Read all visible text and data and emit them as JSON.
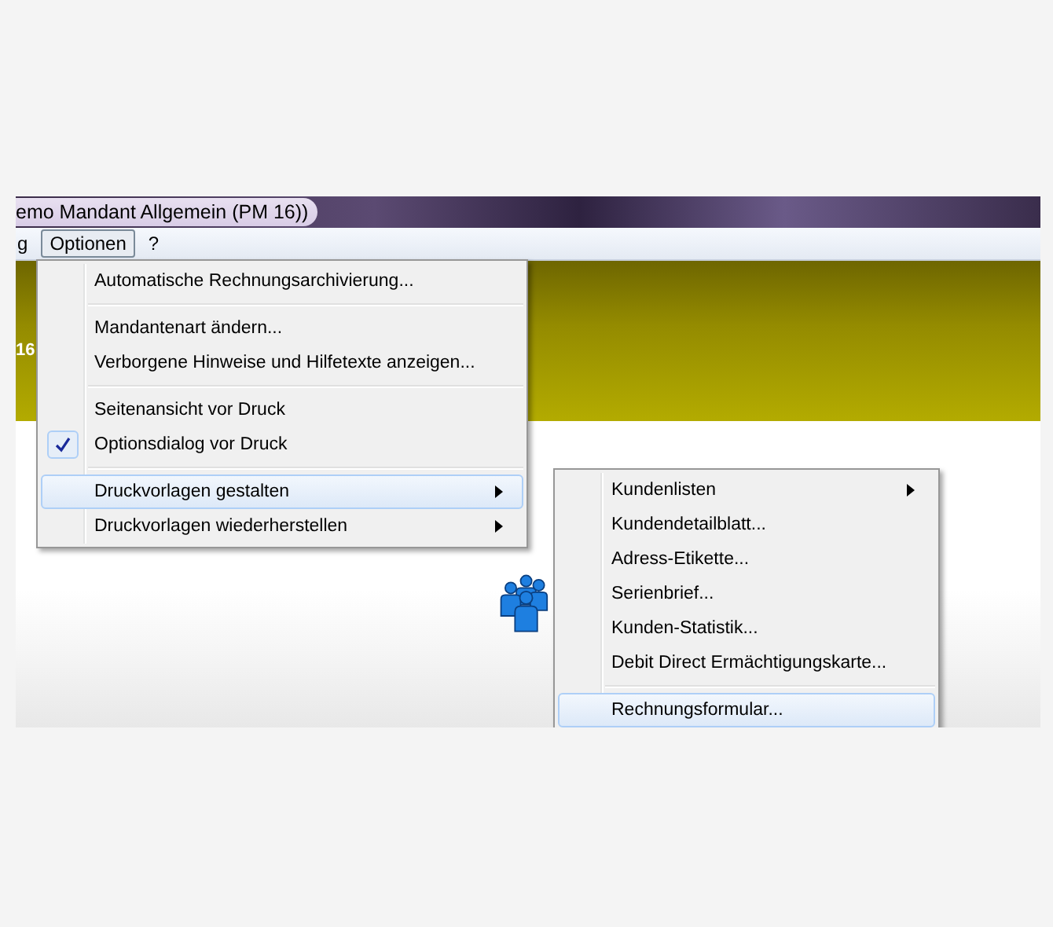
{
  "window": {
    "title": "emo Mandant Allgemein (PM 16))"
  },
  "menubar": [
    {
      "label": "g",
      "selected": false
    },
    {
      "label": "Optionen",
      "selected": true
    },
    {
      "label": "?",
      "selected": false
    }
  ],
  "banner": {
    "text": "16"
  },
  "menu": [
    {
      "kind": "item",
      "label": "Automatische Rechnungsarchivierung...",
      "checked": false,
      "selected": false,
      "submenu": false
    },
    {
      "kind": "separator"
    },
    {
      "kind": "item",
      "label": "Mandantenart ändern...",
      "checked": false,
      "selected": false,
      "submenu": false
    },
    {
      "kind": "item",
      "label": "Verborgene Hinweise und Hilfetexte anzeigen...",
      "checked": false,
      "selected": false,
      "submenu": false
    },
    {
      "kind": "separator"
    },
    {
      "kind": "item",
      "label": "Seitenansicht vor Druck",
      "checked": false,
      "selected": false,
      "submenu": false
    },
    {
      "kind": "item",
      "label": "Optionsdialog vor Druck",
      "checked": true,
      "selected": false,
      "submenu": false
    },
    {
      "kind": "separator"
    },
    {
      "kind": "item",
      "label": "Druckvorlagen gestalten",
      "checked": false,
      "selected": true,
      "submenu": true
    },
    {
      "kind": "item",
      "label": "Druckvorlagen wiederherstellen",
      "checked": false,
      "selected": false,
      "submenu": true
    }
  ],
  "submenu": [
    {
      "kind": "item",
      "label": "Kundenlisten",
      "selected": false,
      "submenu": true
    },
    {
      "kind": "item",
      "label": "Kundendetailblatt...",
      "selected": false,
      "submenu": false
    },
    {
      "kind": "item",
      "label": "Adress-Etikette...",
      "selected": false,
      "submenu": false
    },
    {
      "kind": "item",
      "label": "Serienbrief...",
      "selected": false,
      "submenu": false
    },
    {
      "kind": "item",
      "label": "Kunden-Statistik...",
      "selected": false,
      "submenu": false
    },
    {
      "kind": "item",
      "label": "Debit Direct Ermächtigungskarte...",
      "selected": false,
      "submenu": false
    },
    {
      "kind": "separator"
    },
    {
      "kind": "item",
      "label": "Rechnungsformular...",
      "selected": true,
      "submenu": false
    }
  ]
}
